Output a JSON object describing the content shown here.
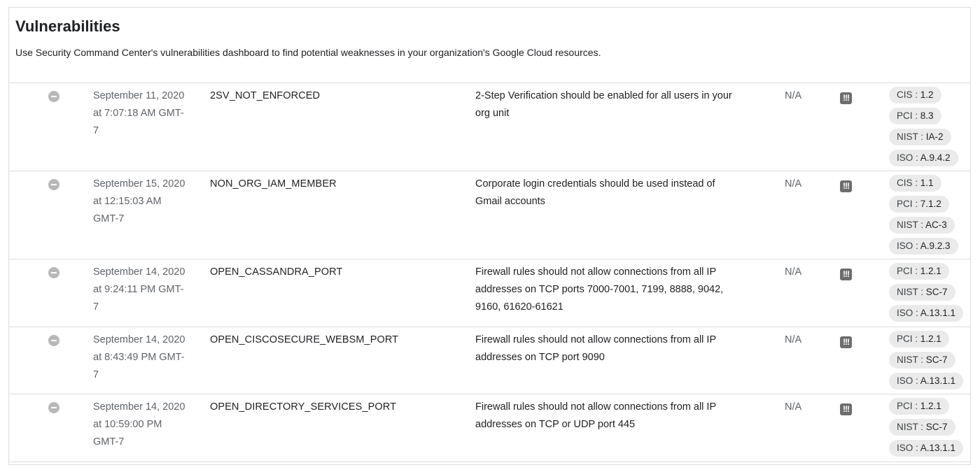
{
  "page": {
    "title": "Vulnerabilities",
    "description": "Use Security Command Center's vulnerabilities dashboard to find potential weaknesses in your organization's Google Cloud resources."
  },
  "icons": {
    "status": "remove-circle-icon",
    "severity": "severity-icon",
    "severity_glyph": "!!!"
  },
  "rows": [
    {
      "time": "September 11, 2020 at 7:07:18 AM GMT-7",
      "category": "2SV_NOT_ENFORCED",
      "description": "2-Step Verification should be enabled for all users in your org unit",
      "severity": "N/A",
      "compliance": [
        {
          "std": "CIS :",
          "val": "1.2"
        },
        {
          "std": "PCI :",
          "val": "8.3"
        },
        {
          "std": "NIST :",
          "val": "IA-2"
        },
        {
          "std": "ISO :",
          "val": "A.9.4.2"
        }
      ]
    },
    {
      "time": "September 15, 2020 at 12:15:03 AM GMT-7",
      "category": "NON_ORG_IAM_MEMBER",
      "description": "Corporate login credentials should be used instead of Gmail accounts",
      "severity": "N/A",
      "compliance": [
        {
          "std": "CIS :",
          "val": "1.1"
        },
        {
          "std": "PCI :",
          "val": "7.1.2"
        },
        {
          "std": "NIST :",
          "val": "AC-3"
        },
        {
          "std": "ISO :",
          "val": "A.9.2.3"
        }
      ]
    },
    {
      "time": "September 14, 2020 at 9:24:11 PM GMT-7",
      "category": "OPEN_CASSANDRA_PORT",
      "description": "Firewall rules should not allow connections from all IP addresses on TCP ports 7000-7001, 7199, 8888, 9042, 9160, 61620-61621",
      "severity": "N/A",
      "compliance": [
        {
          "std": "PCI :",
          "val": "1.2.1"
        },
        {
          "std": "NIST :",
          "val": "SC-7"
        },
        {
          "std": "ISO :",
          "val": "A.13.1.1"
        }
      ]
    },
    {
      "time": "September 14, 2020 at 8:43:49 PM GMT-7",
      "category": "OPEN_CISCOSECURE_WEBSM_PORT",
      "description": "Firewall rules should not allow connections from all IP addresses on TCP port 9090",
      "severity": "N/A",
      "compliance": [
        {
          "std": "PCI :",
          "val": "1.2.1"
        },
        {
          "std": "NIST :",
          "val": "SC-7"
        },
        {
          "std": "ISO :",
          "val": "A.13.1.1"
        }
      ]
    },
    {
      "time": "September 14, 2020 at 10:59:00 PM GMT-7",
      "category": "OPEN_DIRECTORY_SERVICES_PORT",
      "description": "Firewall rules should not allow connections from all IP addresses on TCP or UDP port 445",
      "severity": "N/A",
      "compliance": [
        {
          "std": "PCI :",
          "val": "1.2.1"
        },
        {
          "std": "NIST :",
          "val": "SC-7"
        },
        {
          "std": "ISO :",
          "val": "A.13.1.1"
        }
      ]
    }
  ]
}
